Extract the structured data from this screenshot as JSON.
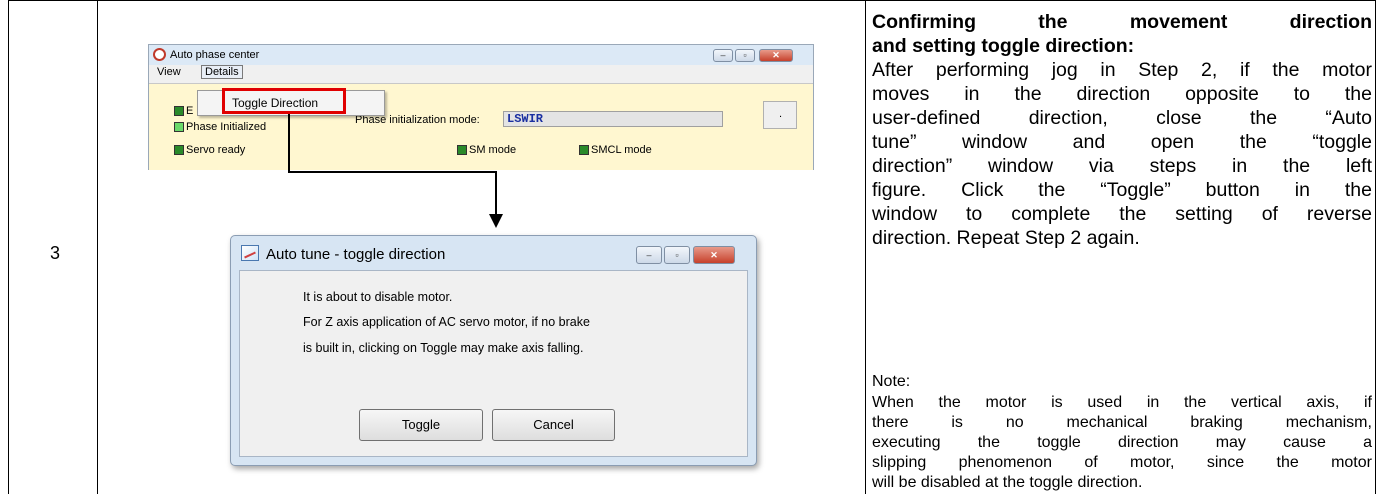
{
  "step": {
    "number": "3"
  },
  "top_window": {
    "title": "Auto phase center",
    "menu": {
      "view": "View",
      "details": "Details"
    },
    "dropdown_item": "Toggle Direction",
    "indicators": {
      "e_partial": "E",
      "phase_initialized": "Phase Initialized",
      "servo_ready": "Servo ready",
      "sm_mode": "SM mode",
      "smcl_mode": "SMCL mode"
    },
    "phase_mode_label": "Phase initialization mode:",
    "phase_mode_value": "LSWIR",
    "dot_button": "."
  },
  "dialog": {
    "title": "Auto tune - toggle direction",
    "lines": [
      "It is about to disable motor.",
      "For Z axis application of AC servo motor, if no brake",
      "is built in, clicking on Toggle may make axis falling."
    ],
    "toggle_button": "Toggle",
    "cancel_button": "Cancel"
  },
  "right": {
    "title_l1a": "Confirming",
    "title_l1b": "the",
    "title_l1c": "movement",
    "title_l1d": "direction",
    "title_l2": "and setting toggle direction:",
    "body": [
      [
        "After",
        "performing",
        "jog",
        "in",
        "Step",
        "2,",
        "if",
        "the",
        "motor"
      ],
      [
        "moves",
        "in",
        "the",
        "direction",
        "opposite",
        "to",
        "the"
      ],
      [
        "user-defined",
        "direction,",
        "close",
        "the",
        "“Auto"
      ],
      [
        "tune”",
        "window",
        "and",
        "open",
        "the",
        "“toggle"
      ],
      [
        "direction”",
        "window",
        "via",
        "steps",
        "in",
        "the",
        "left"
      ],
      [
        "figure.",
        "Click",
        "the",
        "“Toggle”",
        "button",
        "in",
        "the"
      ],
      [
        "window",
        "to",
        "complete",
        "the",
        "setting",
        "of",
        "reverse"
      ],
      [
        "direction. Repeat Step 2 again."
      ]
    ],
    "note_heading": "Note:",
    "note": [
      [
        "When",
        "the",
        "motor",
        "is",
        "used",
        "in",
        "the",
        "vertical",
        "axis,",
        "if"
      ],
      [
        "there",
        "is",
        "no",
        "mechanical",
        "braking",
        "mechanism,"
      ],
      [
        "executing",
        "the",
        "toggle",
        "direction",
        "may",
        "cause",
        "a"
      ],
      [
        "slipping",
        "phenomenon",
        "of",
        "motor,",
        "since",
        "the",
        "motor"
      ],
      [
        "will be disabled at the toggle direction."
      ]
    ]
  },
  "colors": {
    "highlight": "#e00000",
    "panel_yellow": "#fff7d0",
    "phase_value_blue": "#1a2fa0"
  }
}
